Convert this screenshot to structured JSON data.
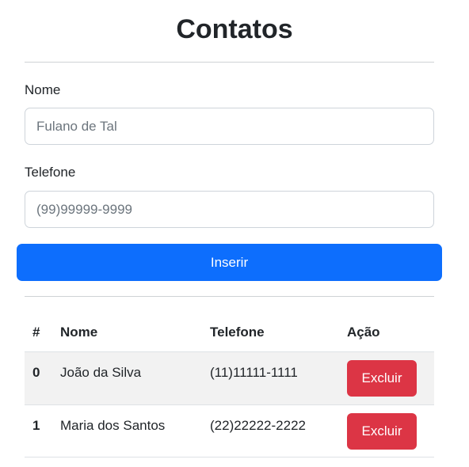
{
  "title": "Contatos",
  "form": {
    "nome_label": "Nome",
    "nome_placeholder": "Fulano de Tal",
    "nome_value": "",
    "telefone_label": "Telefone",
    "telefone_placeholder": "(99)99999-9999",
    "telefone_value": "",
    "insert_button": "Inserir"
  },
  "table": {
    "headers": [
      "#",
      "Nome",
      "Telefone",
      "Ação"
    ],
    "rows": [
      {
        "index": "0",
        "nome": "João da Silva",
        "telefone": "(11)11111-1111",
        "action": "Excluir"
      },
      {
        "index": "1",
        "nome": "Maria dos Santos",
        "telefone": "(22)22222-2222",
        "action": "Excluir"
      }
    ]
  },
  "colors": {
    "primary": "#0d6efd",
    "danger": "#dc3545",
    "stripe": "#f2f2f2"
  }
}
